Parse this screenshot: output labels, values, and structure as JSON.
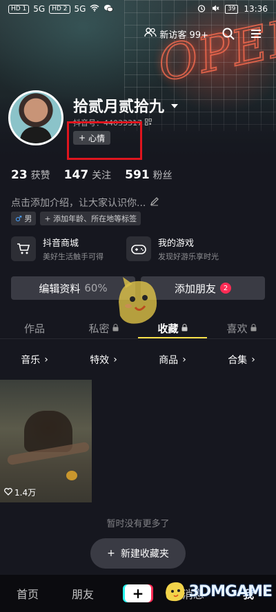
{
  "status_bar": {
    "left": [
      "HD 1",
      "5G",
      "HD 2",
      "5G"
    ],
    "battery": "39",
    "time": "13:36"
  },
  "top_nav": {
    "visitor_label": "新访客 99+"
  },
  "profile": {
    "username": "拾贰月贰拾九",
    "douyin_id": "抖音号：44033317",
    "mood_button": "心情",
    "stats": [
      {
        "value": "23",
        "label": "获赞"
      },
      {
        "value": "147",
        "label": "关注"
      },
      {
        "value": "591",
        "label": "粉丝"
      }
    ],
    "bio_placeholder": "点击添加介绍，让大家认识你...",
    "tags": {
      "gender": "男",
      "add_tags": "添加年龄、所在地等标签"
    }
  },
  "shortcuts": [
    {
      "title": "抖音商城",
      "subtitle": "美好生活触手可得"
    },
    {
      "title": "我的游戏",
      "subtitle": "发现好游乐享时光"
    }
  ],
  "actions": {
    "edit_profile": "编辑资料",
    "edit_percent": "60%",
    "add_friends": "添加朋友",
    "add_friends_badge": "2"
  },
  "tabs": [
    {
      "label": "作品"
    },
    {
      "label": "私密"
    },
    {
      "label": "收藏"
    },
    {
      "label": "喜欢"
    }
  ],
  "subtabs": [
    "音乐",
    "特效",
    "商品",
    "合集"
  ],
  "grid": [
    {
      "likes": "1.4万"
    }
  ],
  "no_more_text": "暂时没有更多了",
  "new_folder_button": "新建收藏夹",
  "bottom_nav": {
    "home": "首页",
    "friends": "朋友",
    "messages": "消息",
    "me": "我"
  },
  "watermark": "3DMGAME",
  "colors": {
    "accent_yellow": "#fbe14a",
    "badge_red": "#fe2c55",
    "highlight_red": "#e0151e",
    "background": "#16171f"
  }
}
